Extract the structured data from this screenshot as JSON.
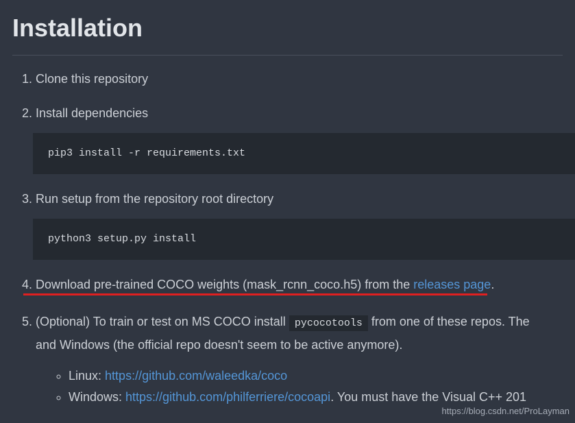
{
  "heading": "Installation",
  "items": {
    "step1": "Clone this repository",
    "step2": "Install dependencies",
    "code2": "pip3 install -r requirements.txt",
    "step3": "Run setup from the repository root directory",
    "code3": "python3 setup.py install",
    "step4_prefix": "Download pre-trained COCO weights (mask_rcnn_coco.h5) from the ",
    "step4_link": "releases page",
    "step4_suffix": ".",
    "step5_a": "(Optional) To train or test on MS COCO install ",
    "step5_code": "pycocotools",
    "step5_b": " from one of these repos. The",
    "step5_c": "and Windows (the official repo doesn't seem to be active anymore).",
    "sub_linux_label": "Linux: ",
    "sub_linux_link": "https://github.com/waleedka/coco",
    "sub_win_label": "Windows: ",
    "sub_win_link": "https://github.com/philferriere/cocoapi",
    "sub_win_tail": ". You must have the Visual C++ 201"
  },
  "watermark": "https://blog.csdn.net/ProLayman"
}
